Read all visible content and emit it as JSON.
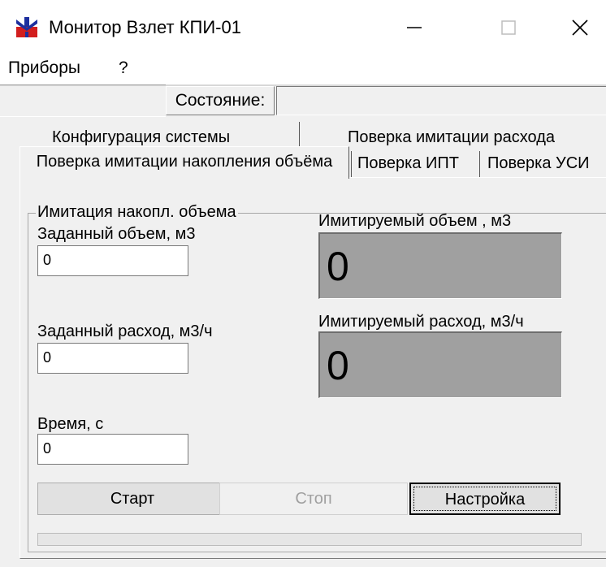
{
  "window": {
    "title": "Монитор Взлет КПИ-01",
    "icon": "app-logo-icon",
    "controls": [
      "minimize-icon",
      "maximize-icon",
      "close-icon"
    ]
  },
  "menu": {
    "items": [
      "Приборы",
      "?"
    ]
  },
  "status": {
    "label": "Состояние:",
    "value": ""
  },
  "tabs": {
    "row1": [
      "Конфигурация системы",
      "Поверка имитации расхода"
    ],
    "row2": [
      "Поверка имитации накопления объёма",
      "Поверка ИПТ",
      "Поверка УСИ"
    ],
    "active": "Поверка имитации накопления объёма"
  },
  "group": {
    "title": "Имитация накопл. объема",
    "fields": {
      "volume": {
        "label": "Заданный объем, м3",
        "value": "0"
      },
      "flow": {
        "label": "Заданный расход, м3/ч",
        "value": "0"
      },
      "time": {
        "label": "Время, с",
        "value": "0"
      }
    },
    "displays": {
      "volume": {
        "label": "Имитируемый объем , м3",
        "value": "0"
      },
      "flow": {
        "label": "Имитируемый расход, м3/ч",
        "value": "0"
      }
    },
    "buttons": {
      "start": "Старт",
      "stop": "Стоп",
      "settings": "Настройка"
    },
    "progress": 0
  },
  "colors": {
    "window_bg": "#f0f0f0",
    "display_bg": "#a0a0a0",
    "logo_blue": "#1d2f9e",
    "logo_red": "#d21e1e"
  }
}
